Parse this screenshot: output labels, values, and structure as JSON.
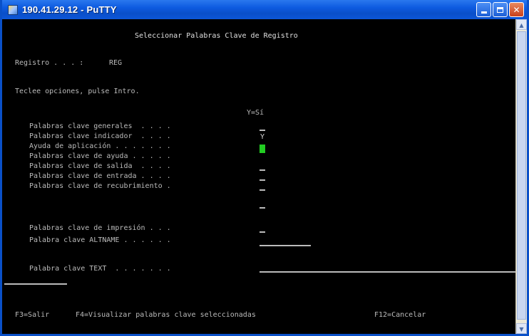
{
  "window": {
    "title": "190.41.29.12 - PuTTY",
    "controls": {
      "minimize": "minimize-icon",
      "maximize": "maximize-icon",
      "close": "close-icon"
    }
  },
  "screen": {
    "title": "Seleccionar Palabras Clave de Registro",
    "record_label": "Registro . . . :",
    "record_value": "REG",
    "instructions": "Teclee opciones, pulse Intro.",
    "column_header": "Y=Sí",
    "options": [
      {
        "label": "Palabras clave generales  . . . .",
        "value": ""
      },
      {
        "label": "Palabras clave indicador  . . . .",
        "value": "Y"
      },
      {
        "label": "Ayuda de aplicación . . . . . . .",
        "value": ""
      },
      {
        "label": "Palabras clave de ayuda . . . . .",
        "value": ""
      },
      {
        "label": "Palabras clave de salida  . . . .",
        "value": ""
      },
      {
        "label": "Palabras clave de entrada . . . .",
        "value": ""
      },
      {
        "label": "Palabras clave de recubrimiento .",
        "value": ""
      },
      {
        "label": "Palabras clave de impresión . . .",
        "value": ""
      },
      {
        "label": "Palabra clave ALTNAME . . . . . .",
        "value": ""
      },
      {
        "label": "Palabra clave TEXT  . . . . . . .",
        "value": ""
      }
    ],
    "function_keys": {
      "f3": "F3=Salir",
      "f4": "F4=Visualizar palabras clave seleccionadas",
      "f12": "F12=Cancelar"
    }
  },
  "colors": {
    "titlebar": "#0a4fc9",
    "terminal_bg": "#000000",
    "terminal_text": "#bbbbbb",
    "cursor": "#22cc22"
  }
}
